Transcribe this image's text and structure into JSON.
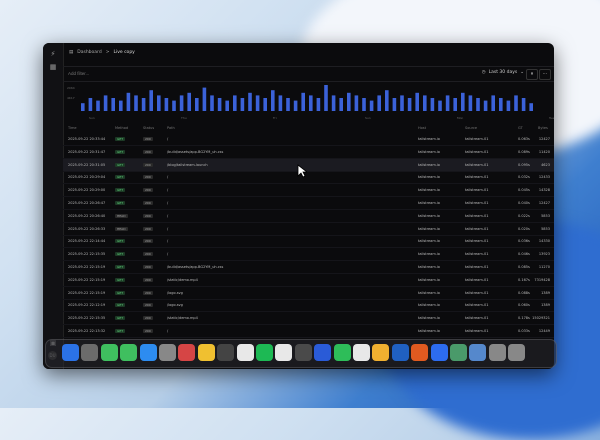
{
  "breadcrumb": {
    "parent": "Dashboard",
    "separator": ">",
    "current": "Live copy"
  },
  "filter": {
    "placeholder": "Add filter..."
  },
  "range": {
    "label": "Last 30 days"
  },
  "chart_data": {
    "type": "bar",
    "values": [
      3,
      5,
      4,
      6,
      5,
      4,
      7,
      6,
      5,
      8,
      6,
      5,
      4,
      6,
      7,
      5,
      9,
      6,
      5,
      4,
      6,
      5,
      7,
      6,
      5,
      8,
      6,
      5,
      4,
      7,
      6,
      5,
      10,
      6,
      5,
      7,
      6,
      5,
      4,
      6,
      8,
      5,
      6,
      5,
      7,
      6,
      5,
      4,
      6,
      5,
      7,
      6,
      5,
      4,
      6,
      5,
      4,
      6,
      5,
      3
    ],
    "xticks": [
      "Sun",
      "Thu",
      "Fri",
      "Sun",
      "Mon",
      "Tue"
    ],
    "yticks": [
      "2064",
      "4K17"
    ]
  },
  "columns": [
    "Time",
    "Method",
    "Status",
    "Path",
    "Host",
    "Source",
    "GT",
    "Bytes"
  ],
  "rows": [
    {
      "time": "2025-09-22 20:33:44",
      "method": "GET",
      "status": "200",
      "path": "/",
      "host": "tailstream.io",
      "source": "tailstream-01",
      "gt": "0.063s",
      "bytes": "12427"
    },
    {
      "time": "2025-09-22 20:31:47",
      "method": "GET",
      "status": "200",
      "path": "/build/assets/app-BG2YM_uh.css",
      "host": "tailstream.io",
      "source": "tailstream-01",
      "gt": "0.089s",
      "bytes": "11420"
    },
    {
      "time": "2025-09-22 20:31:05",
      "method": "GET",
      "status": "200",
      "path": "/blog/tailstream-launch",
      "host": "tailstream.io",
      "source": "tailstream-01",
      "gt": "0.095s",
      "bytes": "4623"
    },
    {
      "time": "2025-09-22 20:29:04",
      "method": "GET",
      "status": "200",
      "path": "/",
      "host": "tailstream.io",
      "source": "tailstream-01",
      "gt": "0.032s",
      "bytes": "12433"
    },
    {
      "time": "2025-09-22 20:29:00",
      "method": "GET",
      "status": "200",
      "path": "/",
      "host": "tailstream.io",
      "source": "tailstream-01",
      "gt": "0.045s",
      "bytes": "14328"
    },
    {
      "time": "2025-09-22 20:26:47",
      "method": "GET",
      "status": "200",
      "path": "/",
      "host": "tailstream.io",
      "source": "tailstream-01",
      "gt": "0.040s",
      "bytes": "12427"
    },
    {
      "time": "2025-09-22 20:26:40",
      "method": "HEAD",
      "status": "200",
      "path": "/",
      "host": "tailstream.io",
      "source": "tailstream-01",
      "gt": "0.022s",
      "bytes": "5853"
    },
    {
      "time": "2025-09-22 20:26:33",
      "method": "HEAD",
      "status": "200",
      "path": "/",
      "host": "tailstream.io",
      "source": "tailstream-01",
      "gt": "0.020s",
      "bytes": "5853"
    },
    {
      "time": "2025-09-22 22:14:44",
      "method": "GET",
      "status": "200",
      "path": "/",
      "host": "tailstream.io",
      "source": "tailstream-01",
      "gt": "0.036s",
      "bytes": "14330"
    },
    {
      "time": "2025-09-22 22:15:35",
      "method": "GET",
      "status": "200",
      "path": "/",
      "host": "tailstream.io",
      "source": "tailstream-01",
      "gt": "0.046s",
      "bytes": "13923"
    },
    {
      "time": "2025-09-22 22:15:19",
      "method": "GET",
      "status": "200",
      "path": "/build/assets/app-BG2YM_uh.css",
      "host": "tailstream.io",
      "source": "tailstream-01",
      "gt": "0.085s",
      "bytes": "11270"
    },
    {
      "time": "2025-09-22 22:15:19",
      "method": "GET",
      "status": "200",
      "path": "/static/demo.mp4",
      "host": "tailstream.io",
      "source": "tailstream-01",
      "gt": "0.167s",
      "bytes": "7319428"
    },
    {
      "time": "2025-09-22 22:15:19",
      "method": "GET",
      "status": "200",
      "path": "/logo.svg",
      "host": "tailstream.io",
      "source": "tailstream-01",
      "gt": "0.088s",
      "bytes": "1389"
    },
    {
      "time": "2025-09-22 22:12:19",
      "method": "GET",
      "status": "200",
      "path": "/logo.svg",
      "host": "tailstream.io",
      "source": "tailstream-01",
      "gt": "0.060s",
      "bytes": "1389"
    },
    {
      "time": "2025-09-22 22:15:35",
      "method": "GET",
      "status": "200",
      "path": "/static/demo.mp4",
      "host": "tailstream.io",
      "source": "tailstream-01",
      "gt": "0.178s",
      "bytes": "15029321"
    },
    {
      "time": "2025-09-22 22:13:32",
      "method": "GET",
      "status": "200",
      "path": "/",
      "host": "tailstream.io",
      "source": "tailstream-01",
      "gt": "0.033s",
      "bytes": "12449"
    }
  ],
  "dock": {
    "colors": [
      "#2b72e6",
      "#6b6b6b",
      "#3fbf5f",
      "#3fbf5f",
      "#2d8cf0",
      "#888",
      "#d64545",
      "#f0c030",
      "#444",
      "#e8e8e8",
      "#1db954",
      "#e8e8e8",
      "#4a4a4a",
      "#2a5bd7",
      "#2ebd59",
      "#e8e8e8",
      "#f0b030",
      "#2060c0",
      "#e05a20",
      "#2d6cf0",
      "#4a9a6a",
      "#5588cc",
      "#888",
      "#888"
    ]
  }
}
